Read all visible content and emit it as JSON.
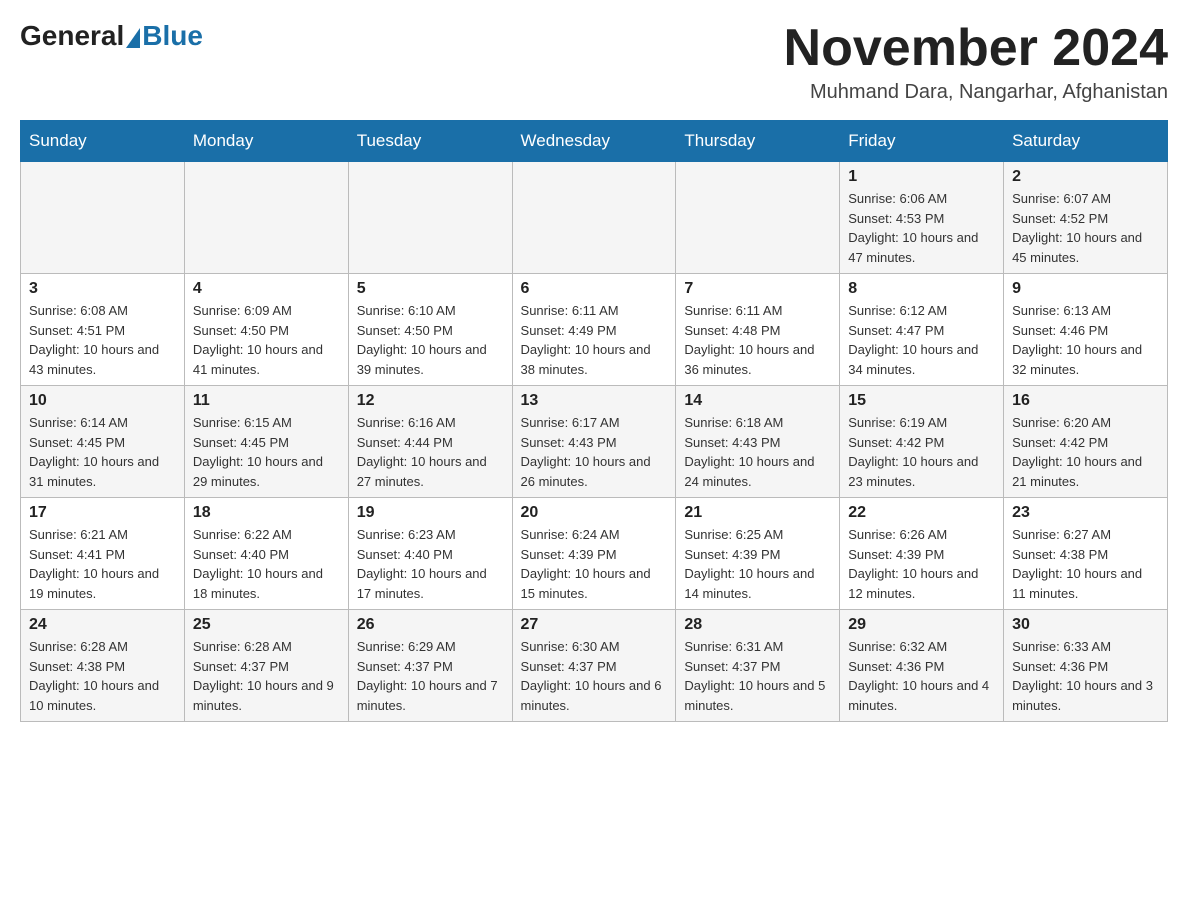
{
  "logo": {
    "general": "General",
    "blue": "Blue"
  },
  "title": "November 2024",
  "location": "Muhmand Dara, Nangarhar, Afghanistan",
  "weekdays": [
    "Sunday",
    "Monday",
    "Tuesday",
    "Wednesday",
    "Thursday",
    "Friday",
    "Saturday"
  ],
  "weeks": [
    [
      {
        "day": "",
        "info": ""
      },
      {
        "day": "",
        "info": ""
      },
      {
        "day": "",
        "info": ""
      },
      {
        "day": "",
        "info": ""
      },
      {
        "day": "",
        "info": ""
      },
      {
        "day": "1",
        "info": "Sunrise: 6:06 AM\nSunset: 4:53 PM\nDaylight: 10 hours and 47 minutes."
      },
      {
        "day": "2",
        "info": "Sunrise: 6:07 AM\nSunset: 4:52 PM\nDaylight: 10 hours and 45 minutes."
      }
    ],
    [
      {
        "day": "3",
        "info": "Sunrise: 6:08 AM\nSunset: 4:51 PM\nDaylight: 10 hours and 43 minutes."
      },
      {
        "day": "4",
        "info": "Sunrise: 6:09 AM\nSunset: 4:50 PM\nDaylight: 10 hours and 41 minutes."
      },
      {
        "day": "5",
        "info": "Sunrise: 6:10 AM\nSunset: 4:50 PM\nDaylight: 10 hours and 39 minutes."
      },
      {
        "day": "6",
        "info": "Sunrise: 6:11 AM\nSunset: 4:49 PM\nDaylight: 10 hours and 38 minutes."
      },
      {
        "day": "7",
        "info": "Sunrise: 6:11 AM\nSunset: 4:48 PM\nDaylight: 10 hours and 36 minutes."
      },
      {
        "day": "8",
        "info": "Sunrise: 6:12 AM\nSunset: 4:47 PM\nDaylight: 10 hours and 34 minutes."
      },
      {
        "day": "9",
        "info": "Sunrise: 6:13 AM\nSunset: 4:46 PM\nDaylight: 10 hours and 32 minutes."
      }
    ],
    [
      {
        "day": "10",
        "info": "Sunrise: 6:14 AM\nSunset: 4:45 PM\nDaylight: 10 hours and 31 minutes."
      },
      {
        "day": "11",
        "info": "Sunrise: 6:15 AM\nSunset: 4:45 PM\nDaylight: 10 hours and 29 minutes."
      },
      {
        "day": "12",
        "info": "Sunrise: 6:16 AM\nSunset: 4:44 PM\nDaylight: 10 hours and 27 minutes."
      },
      {
        "day": "13",
        "info": "Sunrise: 6:17 AM\nSunset: 4:43 PM\nDaylight: 10 hours and 26 minutes."
      },
      {
        "day": "14",
        "info": "Sunrise: 6:18 AM\nSunset: 4:43 PM\nDaylight: 10 hours and 24 minutes."
      },
      {
        "day": "15",
        "info": "Sunrise: 6:19 AM\nSunset: 4:42 PM\nDaylight: 10 hours and 23 minutes."
      },
      {
        "day": "16",
        "info": "Sunrise: 6:20 AM\nSunset: 4:42 PM\nDaylight: 10 hours and 21 minutes."
      }
    ],
    [
      {
        "day": "17",
        "info": "Sunrise: 6:21 AM\nSunset: 4:41 PM\nDaylight: 10 hours and 19 minutes."
      },
      {
        "day": "18",
        "info": "Sunrise: 6:22 AM\nSunset: 4:40 PM\nDaylight: 10 hours and 18 minutes."
      },
      {
        "day": "19",
        "info": "Sunrise: 6:23 AM\nSunset: 4:40 PM\nDaylight: 10 hours and 17 minutes."
      },
      {
        "day": "20",
        "info": "Sunrise: 6:24 AM\nSunset: 4:39 PM\nDaylight: 10 hours and 15 minutes."
      },
      {
        "day": "21",
        "info": "Sunrise: 6:25 AM\nSunset: 4:39 PM\nDaylight: 10 hours and 14 minutes."
      },
      {
        "day": "22",
        "info": "Sunrise: 6:26 AM\nSunset: 4:39 PM\nDaylight: 10 hours and 12 minutes."
      },
      {
        "day": "23",
        "info": "Sunrise: 6:27 AM\nSunset: 4:38 PM\nDaylight: 10 hours and 11 minutes."
      }
    ],
    [
      {
        "day": "24",
        "info": "Sunrise: 6:28 AM\nSunset: 4:38 PM\nDaylight: 10 hours and 10 minutes."
      },
      {
        "day": "25",
        "info": "Sunrise: 6:28 AM\nSunset: 4:37 PM\nDaylight: 10 hours and 9 minutes."
      },
      {
        "day": "26",
        "info": "Sunrise: 6:29 AM\nSunset: 4:37 PM\nDaylight: 10 hours and 7 minutes."
      },
      {
        "day": "27",
        "info": "Sunrise: 6:30 AM\nSunset: 4:37 PM\nDaylight: 10 hours and 6 minutes."
      },
      {
        "day": "28",
        "info": "Sunrise: 6:31 AM\nSunset: 4:37 PM\nDaylight: 10 hours and 5 minutes."
      },
      {
        "day": "29",
        "info": "Sunrise: 6:32 AM\nSunset: 4:36 PM\nDaylight: 10 hours and 4 minutes."
      },
      {
        "day": "30",
        "info": "Sunrise: 6:33 AM\nSunset: 4:36 PM\nDaylight: 10 hours and 3 minutes."
      }
    ]
  ]
}
